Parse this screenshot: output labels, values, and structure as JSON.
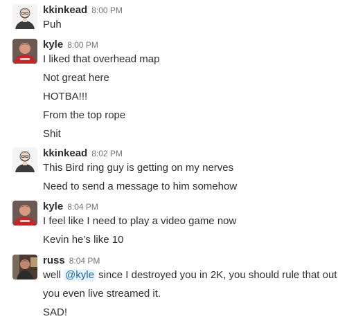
{
  "groups": [
    {
      "author": "kkinkead",
      "time": "8:00 PM",
      "avatar_icon": "kkinkead-avatar",
      "messages": [
        "Puh"
      ]
    },
    {
      "author": "kyle",
      "time": "8:00 PM",
      "avatar_icon": "kyle-avatar",
      "messages": [
        "I liked that overhead map",
        "Not great here",
        "HOTBA!!!",
        "From the top rope",
        "Shit"
      ]
    },
    {
      "author": "kkinkead",
      "time": "8:02 PM",
      "avatar_icon": "kkinkead-avatar",
      "messages": [
        "This Bird ring guy is getting on my nerves",
        "Need to send a message to him somehow"
      ]
    },
    {
      "author": "kyle",
      "time": "8:04 PM",
      "avatar_icon": "kyle-avatar",
      "messages": [
        "I feel like I need to play a video game now",
        "Kevin he’s like 10"
      ]
    },
    {
      "author": "russ",
      "time": "8:04 PM",
      "avatar_icon": "russ-avatar",
      "messages": [
        {
          "before": "well ",
          "mention": "@kyle",
          "after": " since I destroyed you in 2K, you should rule that out"
        },
        "you even live streamed it.",
        "SAD!"
      ]
    }
  ],
  "colors": {
    "mention": "#1264a3",
    "mention_bg": "#e8f3fb",
    "text": "#2c2d30",
    "timestamp": "#717274"
  }
}
